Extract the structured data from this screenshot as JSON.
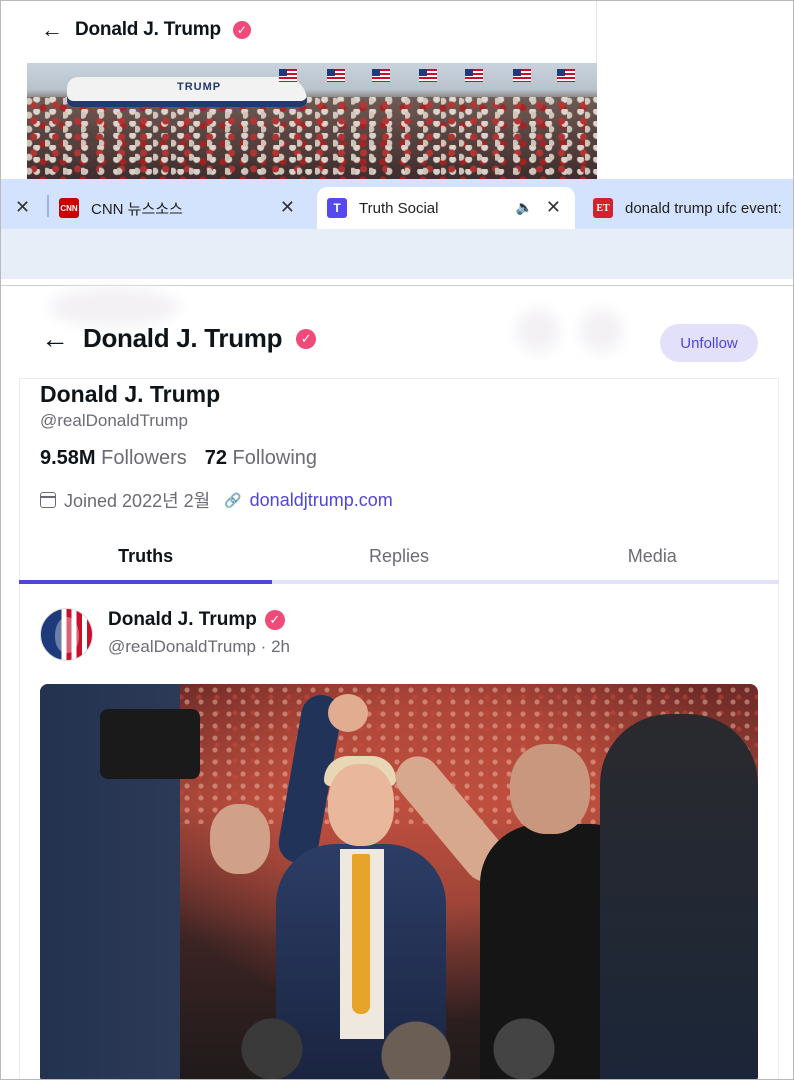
{
  "background_page": {
    "title": "Donald J. Trump",
    "banner_plane_text": "TRUMP"
  },
  "browser": {
    "tabs": [
      {
        "title": "CNN 뉴스소스",
        "favicon": "cnn-favicon",
        "favicon_text": "CNN"
      },
      {
        "title": "Truth Social",
        "favicon": "truth-social-favicon",
        "favicon_text": "T",
        "active": true,
        "audio": true
      },
      {
        "title": "donald trump ufc event:",
        "favicon": "et-favicon",
        "favicon_text": "ET"
      }
    ]
  },
  "header": {
    "title": "Donald J. Trump",
    "unfollow_label": "Unfollow"
  },
  "profile": {
    "name": "Donald J. Trump",
    "handle": "@realDonaldTrump",
    "followers_count": "9.58M",
    "followers_label": "Followers",
    "following_count": "72",
    "following_label": "Following",
    "joined": "Joined 2022년 2월",
    "website": "donaldjtrump.com"
  },
  "tabs": [
    {
      "label": "Truths",
      "active": true
    },
    {
      "label": "Replies",
      "active": false
    },
    {
      "label": "Media",
      "active": false
    }
  ],
  "post": {
    "author": "Donald J. Trump",
    "meta": "@realDonaldTrump · 2h"
  },
  "colors": {
    "accent": "#4f45d8",
    "verified": "#f04a7a",
    "tabstrip": "#d3e3fd"
  }
}
